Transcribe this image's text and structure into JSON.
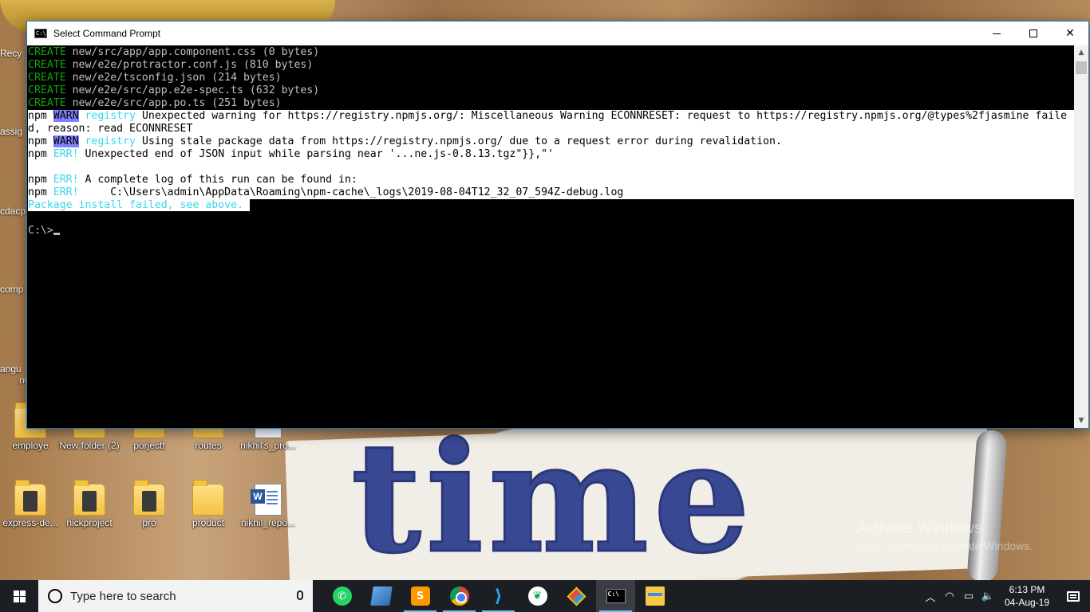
{
  "desktop": {
    "left_edge_labels": [
      "Recy",
      "assig",
      "cdacp",
      "comp",
      "angu",
      "nc"
    ],
    "icons_row1": [
      {
        "label": "employe",
        "type": "folder"
      },
      {
        "label": "New folder (2)",
        "type": "folder"
      },
      {
        "label": "porjectt",
        "type": "folder"
      },
      {
        "label": "routes",
        "type": "folder"
      },
      {
        "label": "nikhil's_pro...",
        "type": "document"
      }
    ],
    "icons_row2": [
      {
        "label": "express-de...",
        "type": "folder-dark"
      },
      {
        "label": "nickproject",
        "type": "folder-dark"
      },
      {
        "label": "pro",
        "type": "folder-dark"
      },
      {
        "label": "product",
        "type": "folder"
      },
      {
        "label": "nikhil_repo...",
        "type": "document"
      }
    ],
    "activate_windows": {
      "line1": "Activate Windows",
      "line2": "Go to Settings to activate Windows."
    }
  },
  "window": {
    "title": "Select Command Prompt",
    "icon": "cmd-icon",
    "controls": {
      "minimize": "minimize-icon",
      "maximize": "maximize-icon",
      "close": "✕"
    }
  },
  "terminal": {
    "create_lines": [
      {
        "tag": "CREATE",
        "text": " new/src/app/app.component.css (0 bytes)"
      },
      {
        "tag": "CREATE",
        "text": " new/e2e/protractor.conf.js (810 bytes)"
      },
      {
        "tag": "CREATE",
        "text": " new/e2e/tsconfig.json (214 bytes)"
      },
      {
        "tag": "CREATE",
        "text": " new/e2e/src/app.e2e-spec.ts (632 bytes)"
      },
      {
        "tag": "CREATE",
        "text": " new/e2e/src/app.po.ts (251 bytes)"
      }
    ],
    "warn1": {
      "prefix": "npm ",
      "tag": "WARN",
      "registry": " registry",
      "text": " Unexpected warning for https://registry.npmjs.org/: Miscellaneous Warning ECONNRESET: request to https://registry.npmjs.org/@types%2fjasmine faile"
    },
    "warn1_cont": "d, reason: read ECONNRESET",
    "warn2": {
      "prefix": "npm ",
      "tag": "WARN",
      "registry": " registry",
      "text": " Using stale package data from https://registry.npmjs.org/ due to a request error during revalidation."
    },
    "err1": {
      "prefix": "npm ",
      "tag": "ERR!",
      "text": " Unexpected end of JSON input while parsing near '...ne.js-0.8.13.tgz\"}},\"'"
    },
    "err2": {
      "prefix": "npm ",
      "tag": "ERR!",
      "text": " A complete log of this run can be found in:"
    },
    "err3": {
      "prefix": "npm ",
      "tag": "ERR!",
      "text": "     C:\\Users\\admin\\AppData\\Roaming\\npm-cache\\_logs\\2019-08-04T12_32_07_594Z-debug.log"
    },
    "failed": "Package install failed, see above. ",
    "prompt": "C:\\>"
  },
  "taskbar": {
    "search_placeholder": "Type here to search",
    "apps": [
      {
        "name": "whatsapp",
        "icon": "whatsapp-icon"
      },
      {
        "name": "this-pc",
        "icon": "computer-icon"
      },
      {
        "name": "sublime-text",
        "icon": "sublime-icon"
      },
      {
        "name": "chrome",
        "icon": "chrome-icon"
      },
      {
        "name": "vscode",
        "icon": "vscode-icon"
      },
      {
        "name": "mongodb",
        "icon": "mongodb-icon"
      },
      {
        "name": "git",
        "icon": "git-icon"
      },
      {
        "name": "command-prompt",
        "icon": "cmd-icon",
        "active": true
      },
      {
        "name": "file-explorer",
        "icon": "folder-icon"
      }
    ],
    "time": "6:13 PM",
    "date": "04-Aug-19"
  },
  "colors": {
    "terminal_bg": "#000000",
    "terminal_fg": "#c0c0c0",
    "create_green": "#13a10e",
    "err_cyan": "#3ad6ea",
    "taskbar_bg": "#1b1f24",
    "accent": "#76b9ed"
  }
}
